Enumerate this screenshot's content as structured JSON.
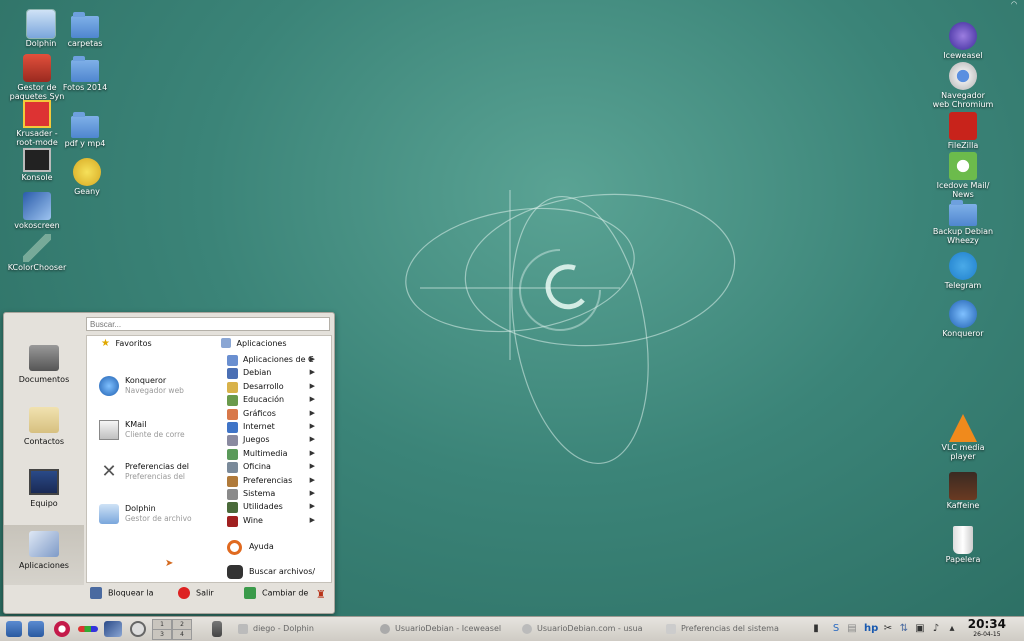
{
  "desktop": {
    "icons_left": [
      {
        "label": "Dolphin",
        "icon": "dolphin-icon"
      },
      {
        "label": "carpetas",
        "icon": "folder-icon"
      },
      {
        "label": "Gestor de paquetes Syn",
        "icon": "synaptic-icon"
      },
      {
        "label": "Fotos 2014",
        "icon": "folder-icon"
      },
      {
        "label": "Krusader - root-mode",
        "icon": "krusader-icon"
      },
      {
        "label": "pdf y mp4",
        "icon": "folder-icon"
      },
      {
        "label": "Konsole",
        "icon": "terminal-icon"
      },
      {
        "label": "Geany",
        "icon": "geany-icon"
      },
      {
        "label": "vokoscreen",
        "icon": "vokoscreen-icon"
      },
      {
        "label": "KColorChooser",
        "icon": "color-picker-icon"
      }
    ],
    "icons_right": [
      {
        "label": "Iceweasel",
        "icon": "iceweasel-icon"
      },
      {
        "label": "Navegador web Chromium",
        "icon": "chromium-icon"
      },
      {
        "label": "FileZilla",
        "icon": "filezilla-icon"
      },
      {
        "label": "Icedove Mail/ News",
        "icon": "icedove-icon"
      },
      {
        "label": "Backup Debian Wheezy",
        "icon": "folder-icon"
      },
      {
        "label": "Telegram",
        "icon": "telegram-icon"
      },
      {
        "label": "Konqueror",
        "icon": "konqueror-icon"
      },
      {
        "label": "VLC media player",
        "icon": "vlc-icon"
      },
      {
        "label": "Kaffeine",
        "icon": "kaffeine-icon"
      },
      {
        "label": "Papelera",
        "icon": "trash-icon"
      }
    ]
  },
  "menu": {
    "search_placeholder": "Buscar...",
    "side": [
      {
        "label": "Documentos",
        "icon": "typewriter-icon"
      },
      {
        "label": "Contactos",
        "icon": "contacts-icon"
      },
      {
        "label": "Equipo",
        "icon": "laptop-icon"
      },
      {
        "label": "Aplicaciones",
        "icon": "applications-icon",
        "active": true
      }
    ],
    "favorites_header": "Favoritos",
    "apps_header": "Aplicaciones",
    "favorites": [
      {
        "title": "Konqueror",
        "subtitle": "Navegador web"
      },
      {
        "title": "KMail",
        "subtitle": "Cliente de corre"
      },
      {
        "title": "Preferencias del",
        "subtitle": "Preferencias del"
      },
      {
        "title": "Dolphin",
        "subtitle": "Gestor de archivo"
      }
    ],
    "applications": [
      {
        "label": "Aplicaciones de C",
        "color": "#6a8fd0"
      },
      {
        "label": "Debian",
        "color": "#4a6fb4"
      },
      {
        "label": "Desarrollo",
        "color": "#d8b24a"
      },
      {
        "label": "Educación",
        "color": "#6a9a4c"
      },
      {
        "label": "Gráficos",
        "color": "#d8784a"
      },
      {
        "label": "Internet",
        "color": "#3f74c7"
      },
      {
        "label": "Juegos",
        "color": "#8a8aa0"
      },
      {
        "label": "Multimedia",
        "color": "#5a9a5a"
      },
      {
        "label": "Oficina",
        "color": "#7a8a9a"
      },
      {
        "label": "Preferencias",
        "color": "#b07a3a"
      },
      {
        "label": "Sistema",
        "color": "#8a8a8a"
      },
      {
        "label": "Utilidades",
        "color": "#4a6a3a"
      },
      {
        "label": "Wine",
        "color": "#a02020"
      }
    ],
    "help": "Ayuda",
    "find_files": "Buscar archivos/",
    "bottom": {
      "lock": "Bloquear la",
      "logout": "Salir",
      "switch_user": "Cambiar de"
    }
  },
  "taskbar": {
    "pager": [
      "1",
      "2",
      "3",
      "4"
    ],
    "tasks": [
      {
        "label": "diego - Dolphin"
      },
      {
        "label": "UsuarioDebian - Iceweasel"
      },
      {
        "label": "UsuarioDebian.com - usua"
      },
      {
        "label": "Preferencias del sistema"
      }
    ],
    "clock": {
      "time": "20:34",
      "date": "26-04-15"
    }
  }
}
